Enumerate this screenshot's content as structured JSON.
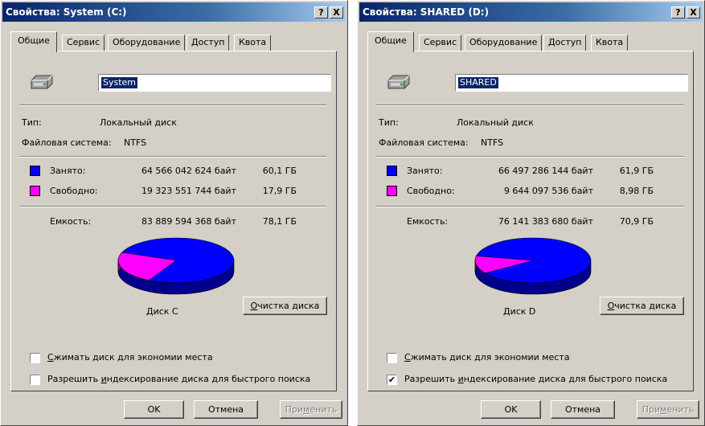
{
  "windows": [
    {
      "title": "Свойства: System (C:)",
      "controls": {
        "help": "?",
        "close": "X"
      },
      "tabs": [
        "Общие",
        "Сервис",
        "Оборудование",
        "Доступ",
        "Квота"
      ],
      "drive_name": "System",
      "type_label": "Тип:",
      "type_value": "Локальный диск",
      "fs_label": "Файловая система:",
      "fs_value": "NTFS",
      "used_label": "Занято:",
      "used_bytes": "64 566 042 624 байт",
      "used_gb": "60,1 ГБ",
      "free_label": "Свободно:",
      "free_bytes": "19 323 551 744 байт",
      "free_gb": "17,9 ГБ",
      "cap_label": "Емкость:",
      "cap_bytes": "83 889 594 368 байт",
      "cap_gb": "78,1 ГБ",
      "used_fraction": 0.77,
      "disk_label": "Диск C",
      "cleanup_label_u": "О",
      "cleanup_label_rest": "чистка диска",
      "compress_u": "С",
      "compress_rest": "жимать диск для экономии места",
      "compress_checked": false,
      "index_pre": "Разрешить ",
      "index_u": "и",
      "index_rest": "ндексирование диска для быстрого поиска",
      "index_checked": false,
      "ok_label": "OK",
      "cancel_label": "Отмена",
      "apply_pre": "При",
      "apply_u": "м",
      "apply_rest": "енить",
      "colors": {
        "used": "#0000ff",
        "free": "#ff00ff"
      }
    },
    {
      "title": "Свойства: SHARED (D:)",
      "controls": {
        "help": "?",
        "close": "X"
      },
      "tabs": [
        "Общие",
        "Сервис",
        "Оборудование",
        "Доступ",
        "Квота"
      ],
      "drive_name": "SHARED",
      "type_label": "Тип:",
      "type_value": "Локальный диск",
      "fs_label": "Файловая система:",
      "fs_value": "NTFS",
      "used_label": "Занято:",
      "used_bytes": "66 497 286 144 байт",
      "used_gb": "61,9 ГБ",
      "free_label": "Свободно:",
      "free_bytes": "9 644 097 536 байт",
      "free_gb": "8,98 ГБ",
      "cap_label": "Емкость:",
      "cap_bytes": "76 141 383 680 байт",
      "cap_gb": "70,9 ГБ",
      "used_fraction": 0.873,
      "disk_label": "Диск D",
      "cleanup_label_u": "О",
      "cleanup_label_rest": "чистка диска",
      "compress_u": "С",
      "compress_rest": "жимать диск для экономии места",
      "compress_checked": false,
      "index_pre": "Разрешить ",
      "index_u": "и",
      "index_rest": "ндексирование диска для быстрого поиска",
      "index_checked": true,
      "ok_label": "OK",
      "cancel_label": "Отмена",
      "apply_pre": "При",
      "apply_u": "м",
      "apply_rest": "енить",
      "colors": {
        "used": "#0000ff",
        "free": "#ff00ff"
      }
    }
  ],
  "check_glyph": "✔"
}
